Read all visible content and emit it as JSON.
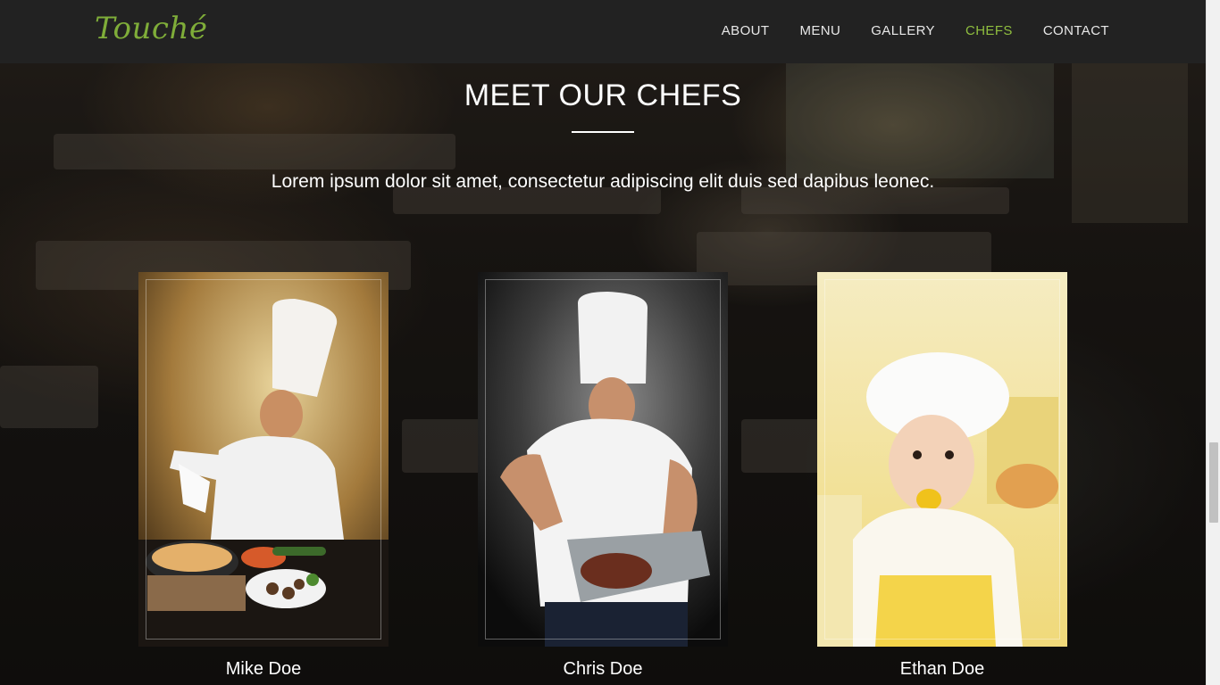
{
  "header": {
    "logo": "Touché",
    "nav": [
      {
        "label": "ABOUT",
        "active": false
      },
      {
        "label": "MENU",
        "active": false
      },
      {
        "label": "GALLERY",
        "active": false
      },
      {
        "label": "CHEFS",
        "active": true
      },
      {
        "label": "CONTACT",
        "active": false
      }
    ]
  },
  "section": {
    "title": "MEET OUR CHEFS",
    "lead": "Lorem ipsum dolor sit amet, consectetur adipiscing elit duis sed dapibus leonec."
  },
  "chefs": [
    {
      "name": "Mike Doe",
      "photo": "chef-with-noodle-dish"
    },
    {
      "name": "Chris Doe",
      "photo": "chef-with-roast-pan"
    },
    {
      "name": "Ethan Doe",
      "photo": "child-chef"
    }
  ],
  "colors": {
    "accent": "#8fbe3f",
    "navbar": "#222222",
    "text": "#ffffff"
  }
}
